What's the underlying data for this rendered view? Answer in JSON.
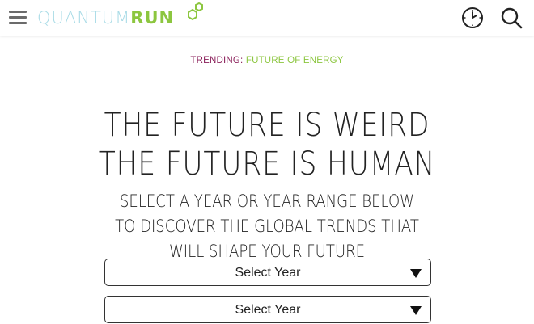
{
  "header": {
    "logo": {
      "part1": "QUANTUM",
      "part2": "RUN"
    },
    "menu_icon": "hamburger-menu-icon",
    "timeline_icon": "clock-icon",
    "search_icon": "search-icon",
    "colors": {
      "logo_light": "#a8dbe6",
      "logo_accent": "#8cc63f"
    }
  },
  "trending": {
    "label": "TRENDING:",
    "link": "FUTURE OF ENERGY",
    "colors": {
      "label": "#8a1f5a",
      "link": "#8cc63f"
    }
  },
  "hero": {
    "line1": "THE FUTURE IS WEIRD",
    "line2": "THE FUTURE IS HUMAN"
  },
  "intro": {
    "line1": "SELECT A YEAR OR YEAR RANGE BELOW",
    "line2": "TO DISCOVER THE GLOBAL TRENDS THAT",
    "line3": "WILL SHAPE YOUR FUTURE"
  },
  "year_selects": [
    {
      "value": "Select Year"
    },
    {
      "value": "Select Year"
    }
  ]
}
